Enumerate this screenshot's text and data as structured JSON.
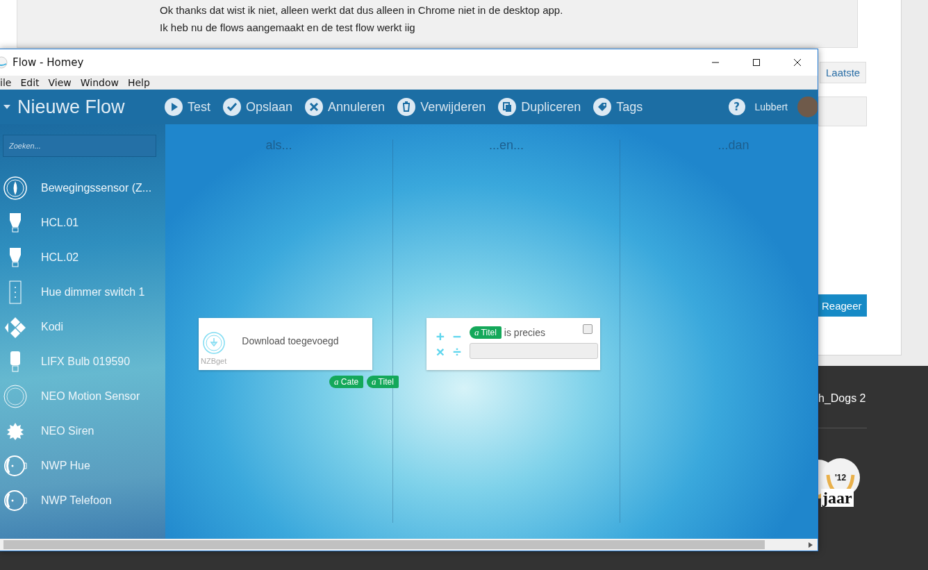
{
  "page": {
    "post_lines": [
      "Ok thanks dat wist ik niet, alleen werkt dat dus alleen in Chrome niet in de desktop app.",
      "Ik heb nu de flows aangemaakt en de test flow werkt iig"
    ],
    "latest_button": "Laatste",
    "reply_button": "Reageer",
    "footer_text": "h_Dogs 2",
    "badge": {
      "year": "'12",
      "caption": "jaar"
    }
  },
  "window": {
    "title": "Flow - Homey",
    "menu": [
      "ile",
      "Edit",
      "View",
      "Window",
      "Help"
    ]
  },
  "toolbar": {
    "flow_title": "Nieuwe Flow",
    "actions": [
      {
        "label": "Test"
      },
      {
        "label": "Opslaan"
      },
      {
        "label": "Annuleren"
      },
      {
        "label": "Verwijderen"
      },
      {
        "label": "Dupliceren"
      },
      {
        "label": "Tags"
      }
    ],
    "help": "?",
    "user": "Lubbert"
  },
  "sidebar": {
    "search": {
      "placeholder": "Zoeken..."
    },
    "devices": [
      {
        "name": "Bewegingssensor (Z..."
      },
      {
        "name": "HCL.01"
      },
      {
        "name": "HCL.02"
      },
      {
        "name": "Hue dimmer switch 1"
      },
      {
        "name": "Kodi"
      },
      {
        "name": "LIFX Bulb 019590"
      },
      {
        "name": "NEO Motion Sensor"
      },
      {
        "name": "NEO Siren"
      },
      {
        "name": "NWP Hue"
      },
      {
        "name": "NWP Telefoon"
      }
    ]
  },
  "columns": [
    {
      "heading": "als...",
      "cards": [
        {
          "kind": "trigger",
          "title": "Download toegevoegd",
          "app": "NZBget",
          "tokens": [
            {
              "glyph": "a",
              "label": "Cate"
            },
            {
              "glyph": "a",
              "label": "Titel"
            }
          ]
        }
      ]
    },
    {
      "heading": "...en...",
      "cards": [
        {
          "kind": "condition",
          "operators": [
            "+",
            "−",
            "×",
            "÷"
          ],
          "token": {
            "glyph": "a",
            "label": "Titel"
          },
          "text": "is precies",
          "checked": false
        }
      ]
    },
    {
      "heading": "...dan"
    }
  ]
}
